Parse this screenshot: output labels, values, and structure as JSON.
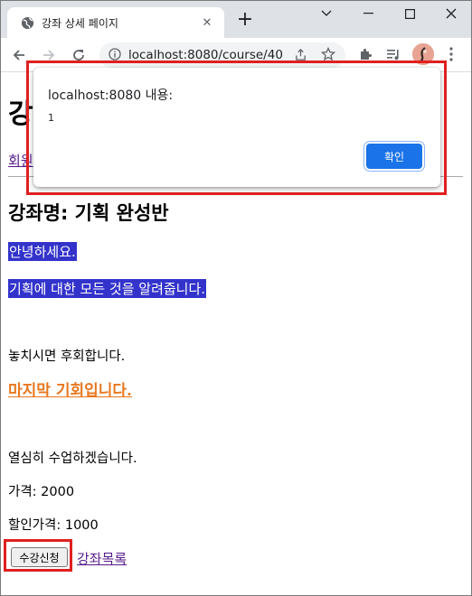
{
  "browser": {
    "tab_title": "강좌 상세 페이지",
    "url": "localhost:8080/course/40"
  },
  "page": {
    "heading_partial": "강",
    "nav_link_partial": "회원",
    "course_title": "강좌명: 기획 완성반",
    "highlight_line1": "안녕하세요.",
    "highlight_line2": "기획에 대한 모든 것을 알려줍니다.",
    "line_miss": "놓치시면 후회합니다.",
    "last_chance": "마지막 기회입니다.",
    "line_study": "열심히 수업하겠습니다.",
    "price": "가격: 2000",
    "sale_price": "할인가격: 1000",
    "enroll_button": "수강신청",
    "course_list_link": "강좌목록"
  },
  "dialog": {
    "title": "localhost:8080 내용:",
    "message": "1",
    "ok_button": "확인"
  },
  "colors": {
    "highlight_bg": "#3333cc",
    "accent_orange": "#e8771f",
    "dialog_button": "#1a73e8",
    "annotation_red": "#e02020"
  }
}
